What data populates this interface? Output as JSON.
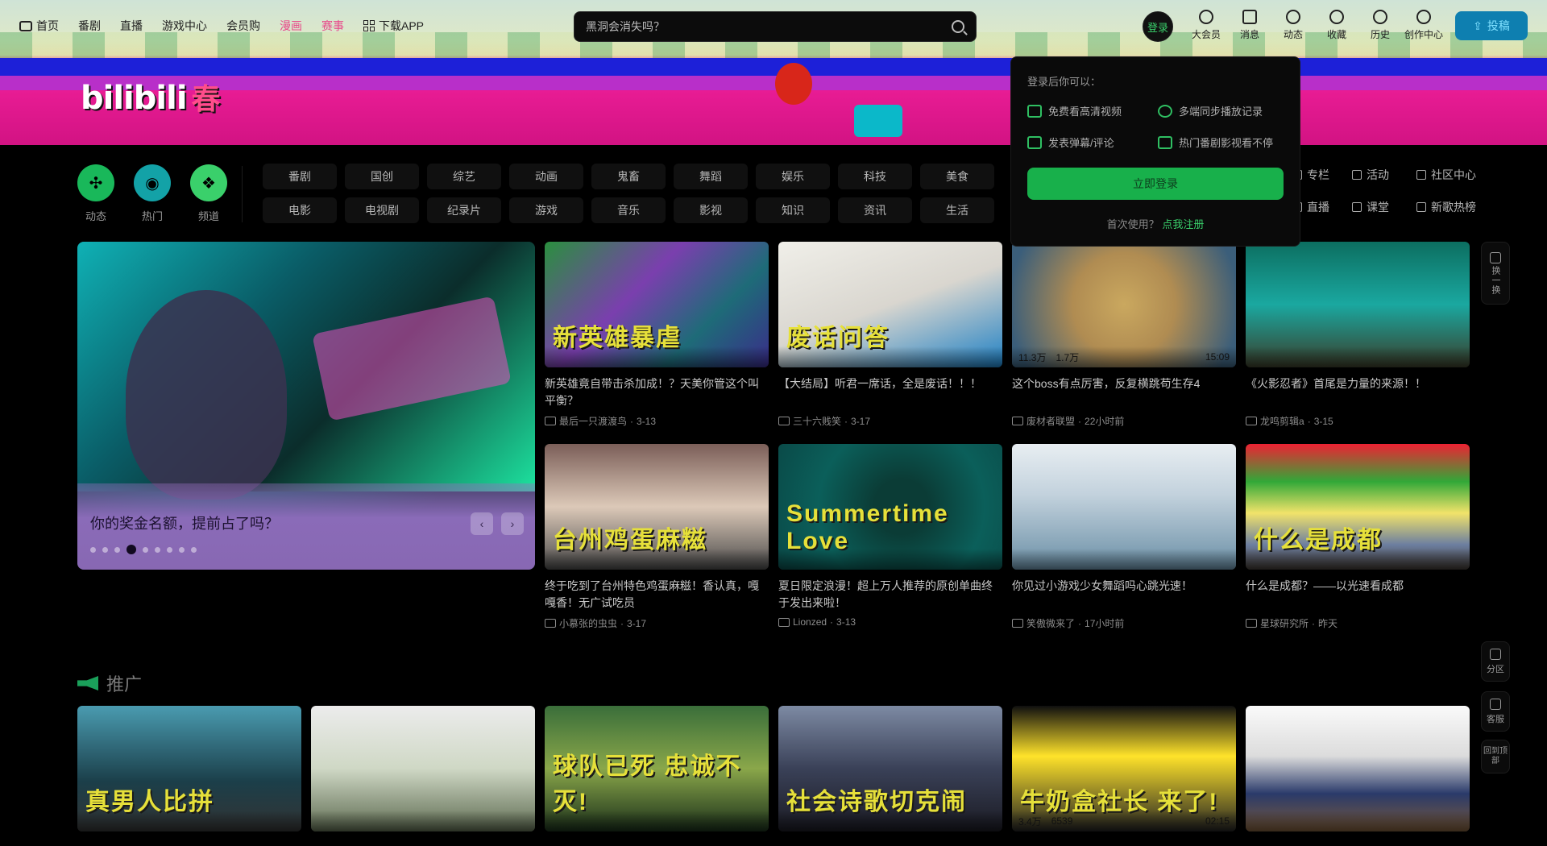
{
  "nav": {
    "left": [
      "首页",
      "番剧",
      "直播",
      "游戏中心",
      "会员购",
      "漫画",
      "赛事",
      "下载APP"
    ],
    "search_placeholder": "黑洞会消失吗？",
    "login_avatar": "登录",
    "right": [
      "大会员",
      "消息",
      "动态",
      "收藏",
      "历史",
      "创作中心"
    ],
    "upload": "投稿"
  },
  "logo": {
    "text": "bilibili",
    "seasonal": "春"
  },
  "channels": {
    "icons": [
      {
        "label": "动态",
        "icon": "fan-icon"
      },
      {
        "label": "热门",
        "icon": "flame-icon"
      },
      {
        "label": "频道",
        "icon": "cluster-icon"
      }
    ],
    "row1": [
      "番剧",
      "国创",
      "综艺",
      "动画",
      "鬼畜",
      "舞蹈",
      "娱乐",
      "科技",
      "美食"
    ],
    "row2": [
      "电影",
      "电视剧",
      "纪录片",
      "游戏",
      "音乐",
      "影视",
      "知识",
      "资讯",
      "生活"
    ],
    "extra": [
      "专栏",
      "活动",
      "社区中心",
      "直播",
      "课堂",
      "新歌热榜"
    ]
  },
  "login_popover": {
    "title": "登录后你可以：",
    "features": [
      "免费看高清视频",
      "多端同步播放记录",
      "发表弹幕/评论",
      "热门番剧影视看不停"
    ],
    "button": "立即登录",
    "register_prompt": "首次使用？",
    "register_link": "点我注册"
  },
  "carousel": {
    "caption": "你的奖金名额，提前占了吗？",
    "prev": "‹",
    "next": "›",
    "dot_count": 9,
    "active_dot": 3
  },
  "videos": [
    {
      "title": "新英雄竟自带击杀加成！？天美你管这个叫平衡？",
      "author": "最后一只渡渡鸟",
      "date": "3-13",
      "thumb_text": "新英雄暴虐",
      "views": "",
      "danmaku": "",
      "duration": ""
    },
    {
      "title": "【大结局】听君一席话，全是废话！！！",
      "author": "三十六贱笑",
      "date": "3-17",
      "thumb_text": "废话问答",
      "views": "",
      "danmaku": "",
      "duration": ""
    },
    {
      "title": "这个boss有点厉害，反复横跳苟生存4",
      "author": "废材者联盟",
      "date": "22小时前",
      "thumb_text": "",
      "views": "11.3万",
      "danmaku": "1.7万",
      "duration": "15:09"
    },
    {
      "title": "《火影忍者》首尾是力量的来源！！",
      "author": "龙鸣剪辑a",
      "date": "3-15",
      "thumb_text": "",
      "views": "",
      "danmaku": "",
      "duration": ""
    },
    {
      "title": "终于吃到了台州特色鸡蛋麻糍！香认真，嘎嘎香！无广试吃员",
      "author": "小慕张的虫虫",
      "date": "3-17",
      "thumb_text": "台州鸡蛋麻糍",
      "views": "",
      "danmaku": "",
      "duration": ""
    },
    {
      "title": "夏日限定浪漫！超上万人推荐的原创单曲终于发出来啦！",
      "author": "Lionzed",
      "date": "3-13",
      "thumb_text": "Summertime Love",
      "views": "",
      "danmaku": "",
      "duration": ""
    },
    {
      "title": "你见过小游戏少女舞蹈吗心跳光速！",
      "author": "笑傲微来了",
      "date": "17小时前",
      "thumb_text": "",
      "views": "",
      "danmaku": "",
      "duration": ""
    },
    {
      "title": "什么是成都？——以光速看成都",
      "author": "星球研究所",
      "date": "昨天",
      "thumb_text": "什么是成都",
      "views": "",
      "danmaku": "",
      "duration": ""
    }
  ],
  "promo": {
    "title": "推广",
    "cards": [
      {
        "thumb_text": "真男人比拼",
        "views": "",
        "danmaku": "",
        "duration": ""
      },
      {
        "thumb_text": "",
        "views": "",
        "danmaku": "",
        "duration": ""
      },
      {
        "thumb_text": "球队已死 忠诚不灭!",
        "views": "",
        "danmaku": "",
        "duration": ""
      },
      {
        "thumb_text": "社会诗歌切克闹",
        "views": "",
        "danmaku": "",
        "duration": ""
      },
      {
        "thumb_text": "牛奶盒社长 来了!",
        "views": "3.4万",
        "danmaku": "6539",
        "duration": "02:15"
      },
      {
        "thumb_text": "",
        "views": "",
        "danmaku": "",
        "duration": ""
      }
    ]
  },
  "float_buttons": [
    "换一换",
    "分区",
    "客服",
    "回到顶部"
  ]
}
